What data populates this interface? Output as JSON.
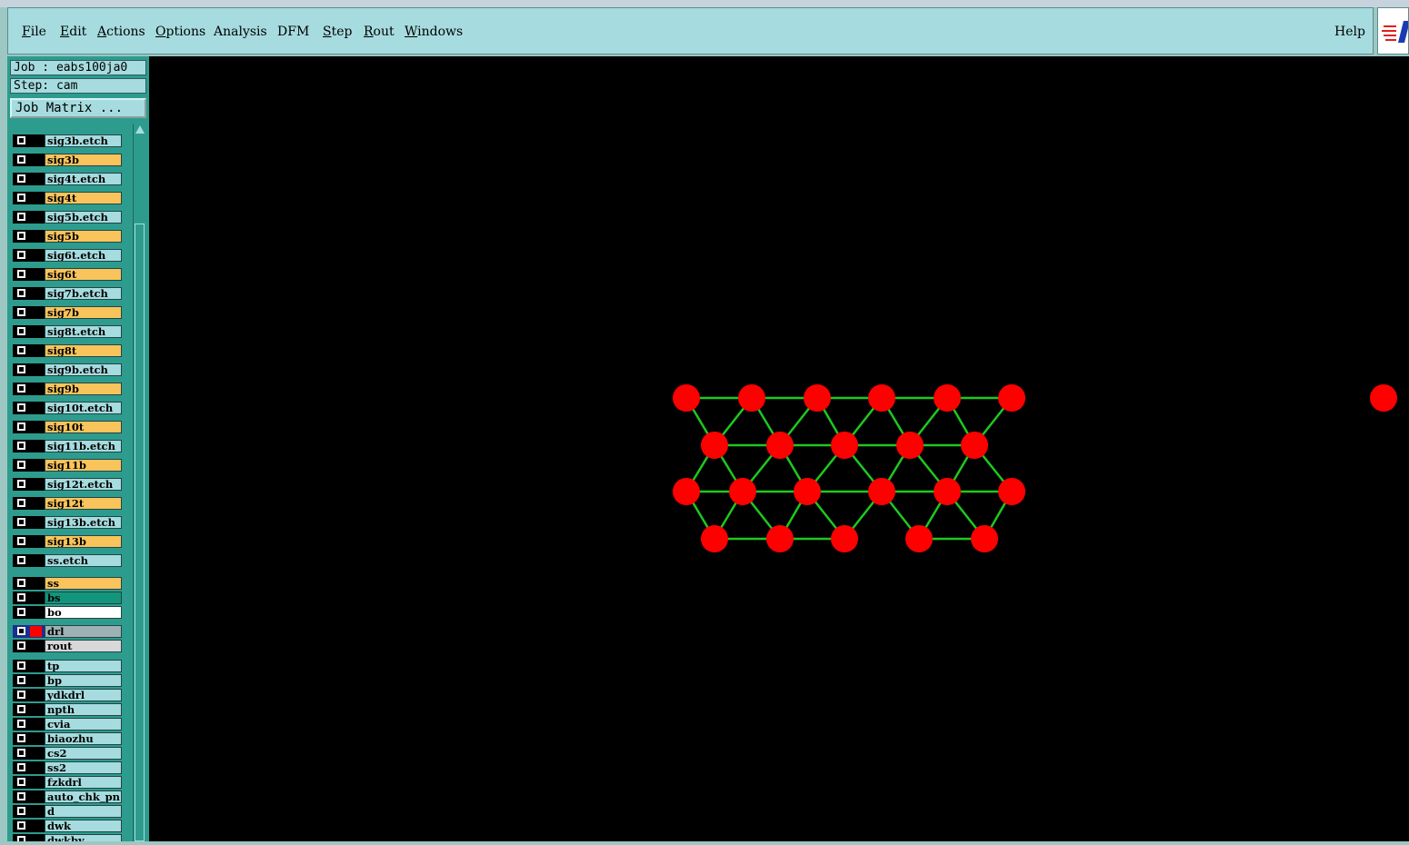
{
  "menu": {
    "items": [
      {
        "label": "File",
        "ul": "F"
      },
      {
        "label": "Edit",
        "ul": "E"
      },
      {
        "label": "Actions",
        "ul": "A"
      },
      {
        "label": "Options",
        "ul": "O"
      },
      {
        "label": "Analysis",
        "ul": ""
      },
      {
        "label": "DFM",
        "ul": ""
      },
      {
        "label": "Step",
        "ul": "S"
      },
      {
        "label": "Rout",
        "ul": "R"
      },
      {
        "label": "Windows",
        "ul": "W"
      }
    ],
    "help": "Help"
  },
  "panel": {
    "job": "Job : eabs100ja0",
    "step": "Step: cam",
    "job_matrix": "Job Matrix ..."
  },
  "colors": {
    "signal": "#f9c45b",
    "etch": "#a6dcdf",
    "bs": "#13957c",
    "bo": "#ffffff",
    "drl": "#9eb2b5",
    "rout": "#d8d8d8",
    "pad": "#ff0000",
    "trace": "#1ec81e"
  },
  "layers": [
    {
      "name": "sig3b.etch",
      "kind": "etch"
    },
    {
      "name": "sig3b",
      "kind": "signal"
    },
    {
      "name": "sig4t.etch",
      "kind": "etch"
    },
    {
      "name": "sig4t",
      "kind": "signal"
    },
    {
      "name": "sig5b.etch",
      "kind": "etch"
    },
    {
      "name": "sig5b",
      "kind": "signal"
    },
    {
      "name": "sig6t.etch",
      "kind": "etch"
    },
    {
      "name": "sig6t",
      "kind": "signal"
    },
    {
      "name": "sig7b.etch",
      "kind": "etch"
    },
    {
      "name": "sig7b",
      "kind": "signal"
    },
    {
      "name": "sig8t.etch",
      "kind": "etch"
    },
    {
      "name": "sig8t",
      "kind": "signal"
    },
    {
      "name": "sig9b.etch",
      "kind": "etch"
    },
    {
      "name": "sig9b",
      "kind": "signal"
    },
    {
      "name": "sig10t.etch",
      "kind": "etch"
    },
    {
      "name": "sig10t",
      "kind": "signal"
    },
    {
      "name": "sig11b.etch",
      "kind": "etch"
    },
    {
      "name": "sig11b",
      "kind": "signal"
    },
    {
      "name": "sig12t.etch",
      "kind": "etch"
    },
    {
      "name": "sig12t",
      "kind": "signal"
    },
    {
      "name": "sig13b.etch",
      "kind": "etch"
    },
    {
      "name": "sig13b",
      "kind": "signal"
    },
    {
      "name": "ss.etch",
      "kind": "etch"
    },
    {
      "name": "ss",
      "kind": "signal"
    },
    {
      "name": "bs",
      "kind": "bs"
    },
    {
      "name": "bo",
      "kind": "bo"
    },
    {
      "name": "drl",
      "kind": "drl",
      "active": true
    },
    {
      "name": "rout",
      "kind": "rout"
    },
    {
      "name": "tp",
      "kind": "etch"
    },
    {
      "name": "bp",
      "kind": "etch"
    },
    {
      "name": "ydkdrl",
      "kind": "etch"
    },
    {
      "name": "npth",
      "kind": "etch"
    },
    {
      "name": "cvia",
      "kind": "etch"
    },
    {
      "name": "biaozhu",
      "kind": "etch"
    },
    {
      "name": "cs2",
      "kind": "etch"
    },
    {
      "name": "ss2",
      "kind": "etch"
    },
    {
      "name": "fzkdrl",
      "kind": "etch"
    },
    {
      "name": "auto_chk_pn",
      "kind": "etch"
    },
    {
      "name": "d",
      "kind": "etch"
    },
    {
      "name": "dwk",
      "kind": "etch"
    },
    {
      "name": "dwkby",
      "kind": "etch"
    }
  ]
}
